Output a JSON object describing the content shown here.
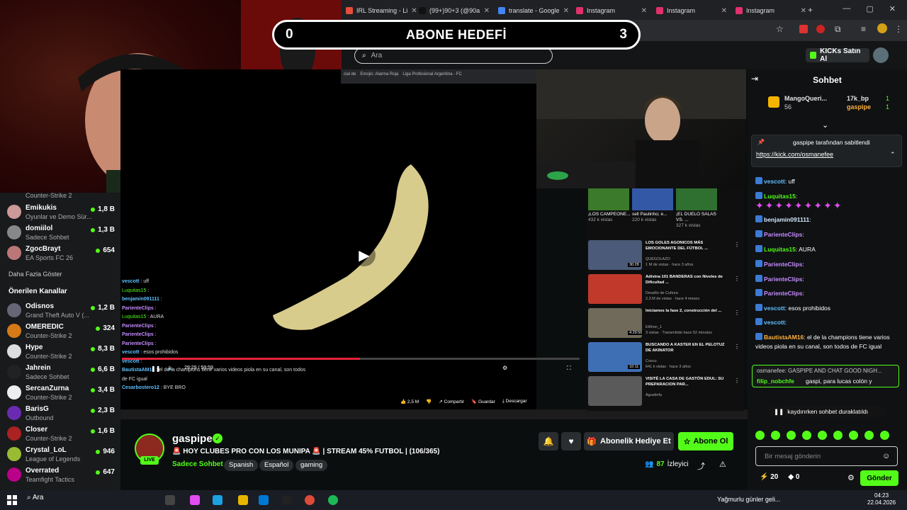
{
  "browser": {
    "tabs": [
      {
        "label": "IRL Streaming - Li",
        "color": "#e74c3c"
      },
      {
        "label": "(99+)90+3 (@90a",
        "color": "#111111"
      },
      {
        "label": "translate - Google",
        "color": "#4285f4"
      },
      {
        "label": "Instagram",
        "color": "#e1306c"
      },
      {
        "label": "Instagram",
        "color": "#e1306c"
      },
      {
        "label": "Instagram",
        "color": "#e1306c"
      }
    ]
  },
  "banner": {
    "left": "0",
    "title": "ABONE HEDEFİ",
    "right": "3"
  },
  "header": {
    "search_placeholder": "Ara",
    "kicks_button": "KICKs Satın Al"
  },
  "sidebar": {
    "top_game": "Counter-Strike 2",
    "channels": [
      {
        "name": "Emikukis",
        "game": "Oyunlar ve Demo Sür...",
        "viewers": "1,8 B",
        "color": "#c99"
      },
      {
        "name": "domiilol",
        "game": "Sadece Sohbet",
        "viewers": "1,3 B",
        "color": "#888"
      },
      {
        "name": "ZgocBrayt",
        "game": "EA Sports FC 26",
        "viewers": "654",
        "color": "#b77"
      }
    ],
    "more_label": "Daha Fazla Göster",
    "recommended_title": "Önerilen Kanallar",
    "recommended": [
      {
        "name": "Odisnos",
        "game": "Grand Theft Auto V (...",
        "viewers": "1,2 B",
        "color": "#667"
      },
      {
        "name": "OMEREDIC",
        "game": "Counter-Strike 2",
        "viewers": "324",
        "color": "#d57a17"
      },
      {
        "name": "Hype",
        "game": "Counter-Strike 2",
        "viewers": "8,3 B",
        "color": "#ddd"
      },
      {
        "name": "Jahrein",
        "game": "Sadece Sohbet",
        "viewers": "6,6 B",
        "color": "#222"
      },
      {
        "name": "SercanZurna",
        "game": "Counter-Strike 2",
        "viewers": "3,4 B",
        "color": "#eee"
      },
      {
        "name": "BarisG",
        "game": "Outbound",
        "viewers": "2,3 B",
        "color": "#6a2bb0"
      },
      {
        "name": "Closer",
        "game": "Counter-Strike 2",
        "viewers": "1,6 B",
        "color": "#a22"
      },
      {
        "name": "Crystal_LoL",
        "game": "League of Legends",
        "viewers": "946",
        "color": "#9b3"
      },
      {
        "name": "Overrated",
        "game": "Teamfight Tactics",
        "viewers": "647",
        "color": "#b08"
      }
    ]
  },
  "video": {
    "time": "29:29 / 59:59",
    "progress": 0.52,
    "overlay_chat": [
      {
        "user": "vescott",
        "text": "uff"
      },
      {
        "user": "Luquitas15",
        "text": ""
      },
      {
        "user": "benjamin091111",
        "text": ""
      },
      {
        "user": "ParienteClips",
        "text": ""
      },
      {
        "user": "Luquitas15",
        "text": "AURA"
      },
      {
        "user": "ParienteClips",
        "text": ""
      },
      {
        "user": "ParienteClips",
        "text": ""
      },
      {
        "user": "ParienteClips",
        "text": ""
      },
      {
        "user": "vescott",
        "text": "esos prohibidos"
      },
      {
        "user": "vescott",
        "text": ""
      },
      {
        "user": "BautistaAM16",
        "text": "el de la champions tiene varios videos piola en su canal, son todos de FC igual"
      },
      {
        "user": "Cesarbostero12",
        "text": "BYE BRO"
      }
    ],
    "actions": {
      "likes": "2,5 M",
      "share": "Compartir",
      "save": "Guardar",
      "download": "Descargar"
    }
  },
  "recommended_videos": {
    "shorts": [
      {
        "title": "¡LOS CAMPEONE...",
        "views": "432 k vistas",
        "color": "#3a7a2a"
      },
      {
        "title": "sell Paulinho; e...",
        "views": "220 k vistas",
        "color": "#3358a6"
      },
      {
        "title": "¡EL DUELO SALAS VS. ...",
        "views": "327 k vistas",
        "color": "#2f6f2f"
      }
    ],
    "videos": [
      {
        "title": "LOS GOLES AGONICOS MÁS EMOCIONANTE DEL FÚTBOL ...",
        "channel": "QUEGOLAZO",
        "meta": "1 M de vistas · hace 3 años",
        "color": "#4a5a78",
        "duration": "30:28"
      },
      {
        "title": "Adivina 101 BANDERAS con Niveles de Dificultad ...",
        "channel": "Desafío de Cultura",
        "meta": "2,3 M de vistas · hace 4 meses",
        "color": "#c0392b",
        "duration": ""
      },
      {
        "title": "Iniciamos la fase 2, construcción del ...",
        "channel": "Elithon_1",
        "meta": "3 vistas · Transmitido hace 52 minutos",
        "color": "#6f6a5a",
        "duration": "4:29:56"
      },
      {
        "title": "BUSCANDO A KASTER EN EL PELOTUZ DE AKINATOR",
        "channel": "Coscu",
        "meta": "641 k vistas · hace 3 años",
        "color": "#3e6fb5",
        "duration": "10:11"
      },
      {
        "title": "VISITÉ LA CASA DE GASTÓN EDUL: SU PREPARACION PAR...",
        "channel": "Agustinfa",
        "meta": "",
        "color": "#5a5a5a",
        "duration": ""
      }
    ]
  },
  "stream": {
    "channel": "gaspipe",
    "title": "🚨 HOY CLUBES PRO CON LOS MUNIPA 🚨 | STREAM 45% FUTBOL | (106/365)",
    "category": "Sadece Sohbet",
    "tags": [
      "Spanish",
      "Español",
      "gaming"
    ],
    "live_label": "LIVE",
    "gift_button": "Abonelik Hediye Et",
    "subscribe_button": "Abone Ol",
    "viewers": "87",
    "viewers_label": "İzleyici"
  },
  "chat": {
    "title": "Sohbet",
    "top_gifters": [
      {
        "name": "MangoQueri...",
        "count": "56"
      },
      {
        "name": "17k_bp",
        "count": "1"
      },
      {
        "name": "gaspipe",
        "count": "1"
      }
    ],
    "pinned_by": "gaspipe tarafından sabitlendi",
    "pinned_link": "https://kick.com/osmanefee",
    "messages": [
      {
        "user": "vescott",
        "text": "uff",
        "color": "#5fc0ff"
      },
      {
        "user": "Luquitas15",
        "text": "",
        "color": "#53fc18"
      },
      {
        "user": "benjamin091111",
        "text": "",
        "color": "#d5e9ff"
      },
      {
        "user": "ParienteClips",
        "text": "",
        "color": "#c58cff"
      },
      {
        "user": "Luquitas15",
        "text": "AURA",
        "color": "#53fc18"
      },
      {
        "user": "ParienteClips",
        "text": "",
        "color": "#c58cff"
      },
      {
        "user": "ParienteClips",
        "text": "",
        "color": "#c58cff"
      },
      {
        "user": "ParienteClips",
        "text": "",
        "color": "#c58cff"
      },
      {
        "user": "vescott",
        "text": "esos prohibidos",
        "color": "#5fc0ff"
      },
      {
        "user": "vescott",
        "text": "",
        "color": "#5fc0ff"
      },
      {
        "user": "BautistaAM16",
        "text": "el de la champions tiene varios videos piola en su canal, son todos de FC igual",
        "color": "#ffb13b"
      },
      {
        "user": "Cesarbostero12",
        "text": "BYE BRO",
        "color": "#ffb13b"
      }
    ],
    "reply_preview": "osmanefee: GASPIPE AND CHAT GOOD NIGH...",
    "reply_user": "filip_nobchfe",
    "reply_text": "gaspi, para lucas colón y",
    "paused_label": "kaydırırken sohbet duraklatıldı",
    "input_placeholder": "Bir mesaj gönderin",
    "points": "20",
    "kicks": "0",
    "send_label": "Gönder"
  },
  "taskbar": {
    "search": "Ara",
    "weather": "Yağmurlu günler geli...",
    "time": "04:23",
    "date": "22.04.2026"
  }
}
